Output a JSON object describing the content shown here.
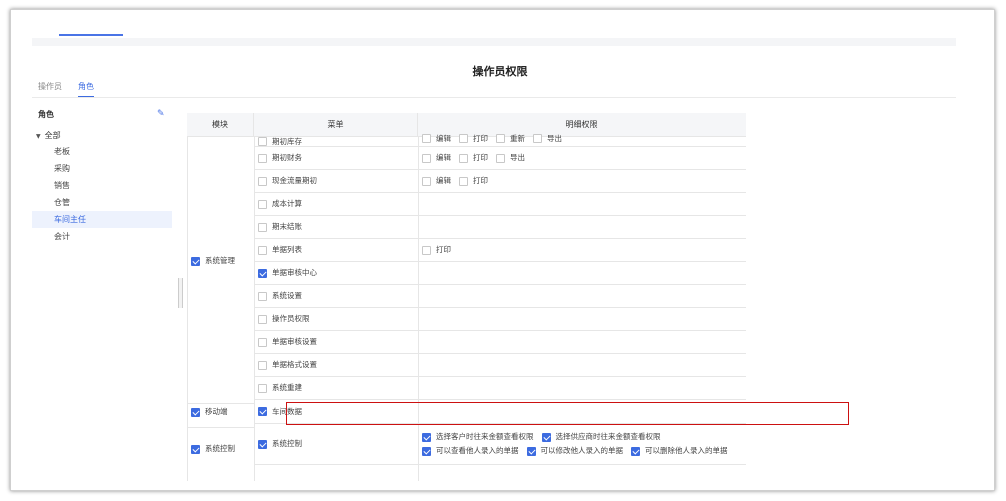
{
  "page_title": "操作员权限",
  "tabs": [
    {
      "label": "操作员",
      "active": false
    },
    {
      "label": "角色",
      "active": true
    }
  ],
  "left_panel": {
    "header": "角色",
    "root": "全部",
    "items": [
      "老板",
      "采购",
      "销售",
      "仓管",
      "车间主任",
      "会计"
    ],
    "selected": "车间主任"
  },
  "table": {
    "headers": {
      "module": "模块",
      "menu": "菜单",
      "perm": "明细权限"
    },
    "modules": {
      "system_manage": {
        "label": "系统管理",
        "checked": true
      },
      "mobile": {
        "label": "移动端",
        "checked": true
      },
      "system_control": {
        "label": "系统控制",
        "checked": true
      }
    },
    "rows": [
      {
        "menu": "期初库存",
        "checked": false,
        "perms": [
          {
            "label": "编辑",
            "checked": false
          },
          {
            "label": "打印",
            "checked": false
          },
          {
            "label": "重新",
            "checked": false
          },
          {
            "label": "导出",
            "checked": false
          }
        ]
      },
      {
        "menu": "期初财务",
        "checked": false,
        "perms": [
          {
            "label": "编辑",
            "checked": false
          },
          {
            "label": "打印",
            "checked": false
          },
          {
            "label": "导出",
            "checked": false
          }
        ]
      },
      {
        "menu": "现金流量期初",
        "checked": false,
        "perms": [
          {
            "label": "编辑",
            "checked": false
          },
          {
            "label": "打印",
            "checked": false
          }
        ]
      },
      {
        "menu": "成本计算",
        "checked": false,
        "perms": []
      },
      {
        "menu": "期末结账",
        "checked": false,
        "perms": []
      },
      {
        "menu": "单据列表",
        "checked": false,
        "perms": [
          {
            "label": "打印",
            "checked": false
          }
        ]
      },
      {
        "menu": "单据审核中心",
        "checked": true,
        "perms": []
      },
      {
        "menu": "系统设置",
        "checked": false,
        "perms": []
      },
      {
        "menu": "操作员权限",
        "checked": false,
        "perms": []
      },
      {
        "menu": "单据审核设置",
        "checked": false,
        "perms": []
      },
      {
        "menu": "单据格式设置",
        "checked": false,
        "perms": []
      },
      {
        "menu": "系统重建",
        "checked": false,
        "perms": []
      },
      {
        "menu": "车间数据",
        "checked": true,
        "perms": []
      },
      {
        "menu": "系统控制",
        "checked": true,
        "perms": [
          {
            "label": "选择客户时往来金额查看权限",
            "checked": true
          },
          {
            "label": "选择供应商时往来金额查看权限",
            "checked": true
          },
          {
            "label": "可以查看他人录入的单据",
            "checked": true
          },
          {
            "label": "可以修改他人录入的单据",
            "checked": true
          },
          {
            "label": "可以删除他人录入的单据",
            "checked": true
          }
        ]
      }
    ]
  },
  "colors": {
    "accent": "#3c6be0",
    "highlight_border": "#cc1111"
  }
}
